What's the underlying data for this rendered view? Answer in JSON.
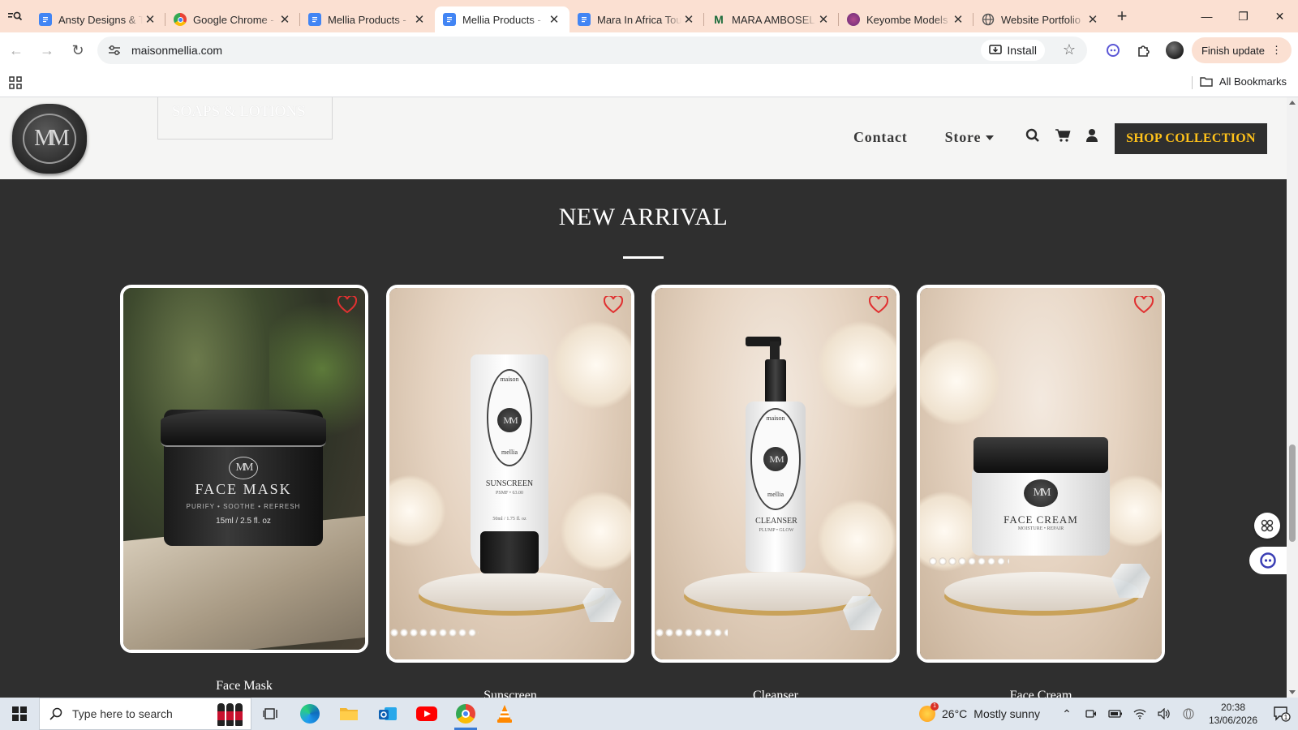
{
  "browser": {
    "tabs": [
      {
        "label": "Ansty Designs & T",
        "favicon": "docs-icon",
        "active": false
      },
      {
        "label": "Google Chrome -",
        "favicon": "chrome-icon",
        "active": false
      },
      {
        "label": "Mellia Products -",
        "favicon": "docs-icon",
        "active": false
      },
      {
        "label": "Mellia Products -",
        "favicon": "docs-icon",
        "active": true
      },
      {
        "label": "Mara In Africa Tou",
        "favicon": "docs-icon",
        "active": false
      },
      {
        "label": "MARA AMBOSELI",
        "favicon": "site-icon",
        "active": false
      },
      {
        "label": "Keyombe Models",
        "favicon": "site-icon",
        "active": false
      },
      {
        "label": "Website Portfolio",
        "favicon": "globe-icon",
        "active": false
      }
    ],
    "url": "maisonmellia.com",
    "install_label": "Install",
    "finish_update_label": "Finish update",
    "all_bookmarks_label": "All Bookmarks"
  },
  "site": {
    "logo_text": "MM",
    "promo_text": "SOAPS & LOTIONS",
    "nav": {
      "contact": "Contact",
      "store": "Store"
    },
    "shop_button": "SHOP COLLECTION",
    "accent_color": "#ffc21a",
    "section_title": "NEW ARRIVAL",
    "products": [
      {
        "name": "Face Mask",
        "label_title": "FACE MASK",
        "label_sub": "PURIFY • SOOTHE • REFRESH",
        "label_size": "15ml / 2.5 fl. oz"
      },
      {
        "name": "Sunscreen",
        "label_brand_top": "maison",
        "label_brand_bottom": "mellia",
        "label_title": "SUNSCREEN",
        "label_sub": "PSMF • 63.00",
        "label_size": "50ml / 1.75 fl. oz"
      },
      {
        "name": "Cleanser",
        "label_brand_top": "maison",
        "label_brand_bottom": "mellia",
        "label_title": "CLEANSER",
        "label_sub": "PLUMP • GLOW"
      },
      {
        "name": "Face Cream",
        "label_title": "FACE CREAM",
        "label_sub": "MOISTURE • REPAIR"
      }
    ]
  },
  "taskbar": {
    "search_placeholder": "Type here to search",
    "weather_temp": "26°C",
    "weather_desc": "Mostly sunny",
    "weather_badge": "1",
    "time": "20:38",
    "date": "13/06/2026",
    "notification_count": "1"
  }
}
